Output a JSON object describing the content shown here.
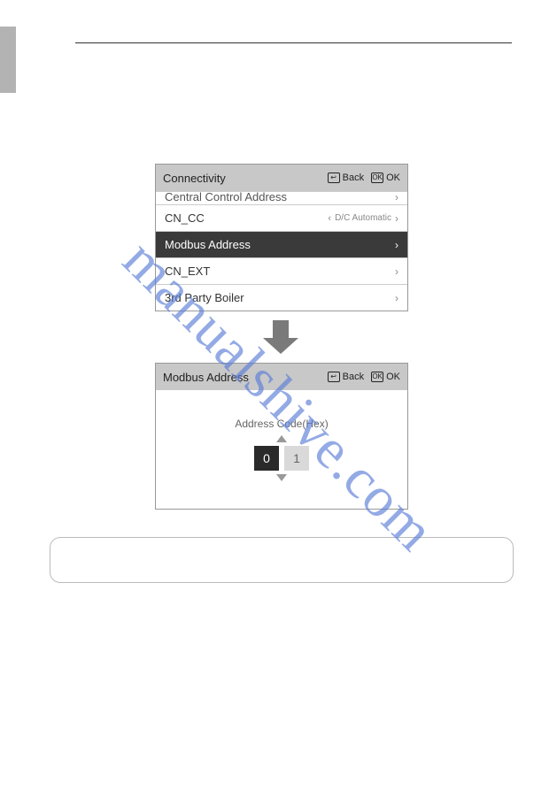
{
  "watermark": "manualshive.com",
  "screen1": {
    "title": "Connectivity",
    "back_label": "Back",
    "ok_label": "OK",
    "items": [
      {
        "label": "Central Control Address"
      },
      {
        "label": "CN_CC",
        "value": "D/C Automatic"
      },
      {
        "label": "Modbus Address"
      },
      {
        "label": "CN_EXT"
      },
      {
        "label": "3rd Party Boiler"
      }
    ]
  },
  "screen2": {
    "title": "Modbus Address",
    "back_label": "Back",
    "ok_label": "OK",
    "code_label": "Address Code(Hex)",
    "digit0": "0",
    "digit1": "1"
  }
}
